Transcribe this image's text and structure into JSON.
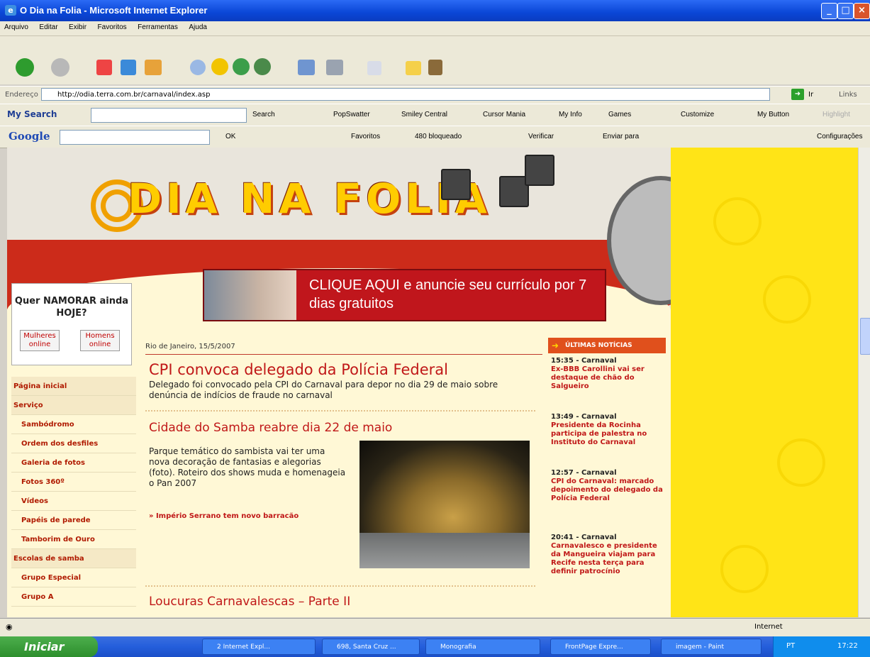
{
  "window": {
    "title": "O Dia na Folia - Microsoft Internet Explorer"
  },
  "menu": [
    "Arquivo",
    "Editar",
    "Exibir",
    "Favoritos",
    "Ferramentas",
    "Ajuda"
  ],
  "address": {
    "label": "Endereço",
    "url": "http://odia.terra.com.br/carnaval/index.asp",
    "go": "Ir",
    "links": "Links"
  },
  "searchbar": {
    "brand": "My Search",
    "items": [
      "Search",
      "PopSwatter",
      "Smiley Central",
      "Cursor Mania",
      "My Info",
      "Games",
      "Customize",
      "My Button",
      "Highlight"
    ]
  },
  "googlebar": {
    "brand": "Google",
    "items": [
      "OK",
      "Favoritos",
      "480 bloqueado",
      "Verificar",
      "Enviar para",
      "Configurações"
    ]
  },
  "banner": {
    "text": "CLIQUE AQUI e anuncie seu currículo por 7 dias gratuitos"
  },
  "namorar": {
    "title": "Quer NAMORAR ainda HOJE?",
    "btn1": "Mulheres online",
    "btn2": "Homens online"
  },
  "sidemenu": [
    {
      "label": "Página inicial",
      "type": "head"
    },
    {
      "label": "Serviço",
      "type": "head"
    },
    {
      "label": "Sambódromo",
      "type": "sub"
    },
    {
      "label": "Ordem dos desfiles",
      "type": "sub"
    },
    {
      "label": "Galeria de fotos",
      "type": "sub"
    },
    {
      "label": "Fotos 360º",
      "type": "sub"
    },
    {
      "label": "Vídeos",
      "type": "sub"
    },
    {
      "label": "Papéis de parede",
      "type": "sub"
    },
    {
      "label": "Tamborim de Ouro",
      "type": "sub"
    },
    {
      "label": "Escolas de samba",
      "type": "head"
    },
    {
      "label": "Grupo Especial",
      "type": "sub"
    },
    {
      "label": "Grupo A",
      "type": "sub"
    }
  ],
  "main": {
    "date": "Rio de Janeiro, 15/5/2007",
    "headline1": "CPI convoca delegado da Polícia Federal",
    "summary1": "Delegado foi convocado pela CPI do Carnaval para depor no dia 29 de maio sobre denúncia de indícios de fraude no carnaval",
    "headline2": "Cidade do Samba reabre dia 22 de maio",
    "summary2": "Parque temático do sambista vai ter uma nova decoração de fantasias e alegorias (foto). Roteiro dos shows muda e homenageia o Pan 2007",
    "link": "» Império Serrano tem novo barracão",
    "headline3": "Loucuras Carnavalescas – Parte II"
  },
  "news": {
    "header": "ÚLTIMAS NOTÍCIAS",
    "items": [
      {
        "time": "15:35 - Carnaval",
        "text": "Ex-BBB Carollini vai ser destaque de chão do Salgueiro"
      },
      {
        "time": "13:49 - Carnaval",
        "text": "Presidente da Rocinha participa de palestra no Instituto do Carnaval"
      },
      {
        "time": "12:57 - Carnaval",
        "text": "CPI do Carnaval: marcado depoimento do delegado da Polícia Federal"
      },
      {
        "time": "20:41 - Carnaval",
        "text": "Carnavalesco e presidente da Mangueira viajam para Recife nesta terça para definir patrocínio"
      }
    ]
  },
  "status": {
    "zone": "Internet"
  },
  "taskbar": {
    "start": "Iniciar",
    "tasks": [
      "2 Internet Expl...",
      "698, Santa Cruz ...",
      "Monografia",
      "FrontPage Expre...",
      "imagem - Paint"
    ],
    "lang": "PT",
    "clock": "17:22"
  },
  "colors": {
    "accent_red": "#c01818",
    "site_yellow": "#ffe417",
    "xp_blue": "#245edb"
  }
}
